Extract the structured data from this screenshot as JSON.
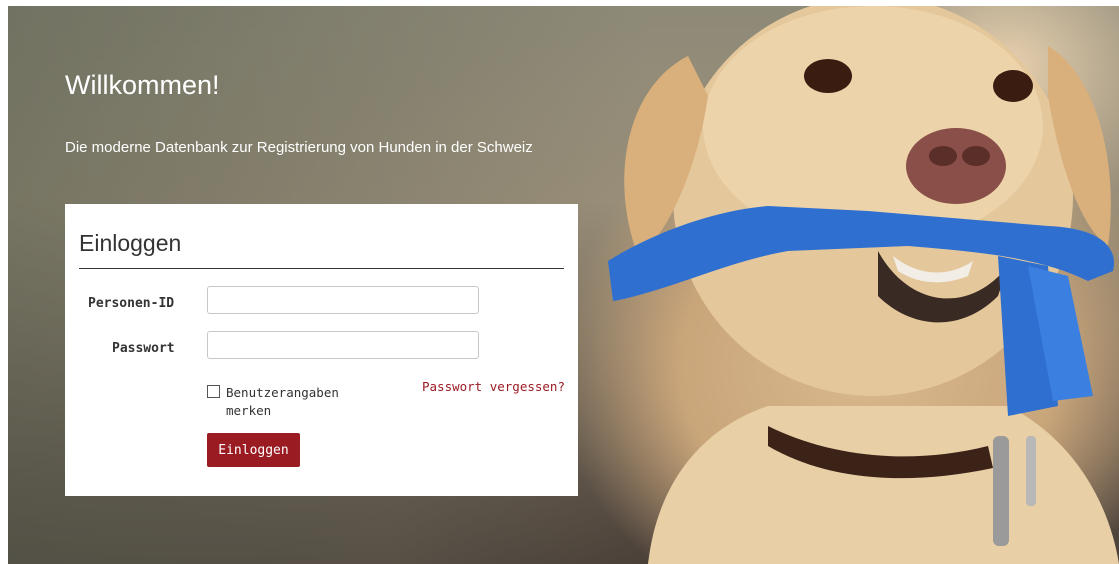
{
  "hero": {
    "title": "Willkommen!",
    "subtitle": "Die moderne Datenbank zur Registrierung von Hunden in der Schweiz"
  },
  "login": {
    "heading": "Einloggen",
    "person_id_label": "Personen-ID",
    "person_id_value": "",
    "password_label": "Passwort",
    "password_value": "",
    "remember_label": "Benutzerangaben merken",
    "remember_checked": false,
    "forgot_link": "Passwort vergessen?",
    "submit_label": "Einloggen"
  },
  "colors": {
    "accent": "#9b1b23",
    "leash": "#2e6fd0",
    "card_bg": "#ffffff"
  }
}
